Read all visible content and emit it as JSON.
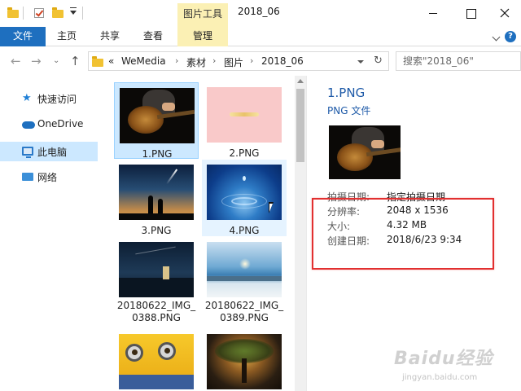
{
  "window": {
    "title": "2018_06",
    "contextual_tab_group": "图片工具"
  },
  "ribbon": {
    "file": "文件",
    "home": "主页",
    "share": "共享",
    "view": "查看",
    "manage": "管理"
  },
  "address": {
    "breadcrumbs": [
      "WeMedia",
      "素材",
      "图片",
      "2018_06"
    ],
    "overflow": "«",
    "search_placeholder": "搜索\"2018_06\""
  },
  "nav_pane": {
    "items": [
      {
        "label": "快速访问",
        "icon": "star-icon"
      },
      {
        "label": "OneDrive",
        "icon": "cloud-icon"
      },
      {
        "label": "此电脑",
        "icon": "computer-icon",
        "selected": true
      },
      {
        "label": "网络",
        "icon": "network-icon"
      }
    ]
  },
  "files": [
    {
      "name": "1.PNG",
      "selected": true
    },
    {
      "name": "2.PNG"
    },
    {
      "name": "3.PNG"
    },
    {
      "name": "4.PNG",
      "hovered": true
    },
    {
      "name_line1": "20180622_IMG_",
      "name_line2": "0388.PNG"
    },
    {
      "name_line1": "20180622_IMG_",
      "name_line2": "0389.PNG"
    },
    {
      "name": ""
    },
    {
      "name": ""
    }
  ],
  "preview": {
    "filename": "1.PNG",
    "filetype": "PNG 文件",
    "properties": [
      {
        "key": "拍摄日期:",
        "value": "指定拍摄日期"
      },
      {
        "key": "分辨率:",
        "value": "2048 x 1536"
      },
      {
        "key": "大小:",
        "value": "4.32 MB"
      },
      {
        "key": "创建日期:",
        "value": "2018/6/23 9:34"
      }
    ]
  },
  "watermark": {
    "main": "Baidu经验",
    "sub": "jingyan.baidu.com"
  },
  "colors": {
    "accent": "#1e6fbf",
    "contextual_tab": "#fbf0b4",
    "selection": "#cce8ff",
    "highlight_box": "#e23030",
    "link_text": "#1e5aa8"
  }
}
